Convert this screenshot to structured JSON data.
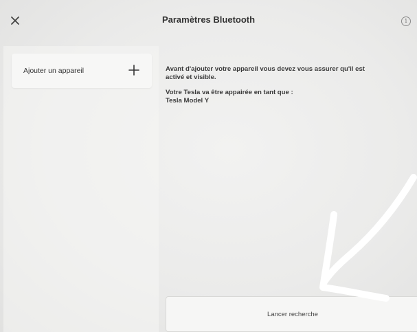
{
  "header": {
    "title": "Paramètres Bluetooth",
    "close_icon": "close-icon",
    "info_icon": "info-icon",
    "info_glyph": "i"
  },
  "sidebar": {
    "add_device_label": "Ajouter un appareil",
    "add_icon": "plus-icon"
  },
  "main": {
    "instruction_line1": "Avant d'ajouter votre appareil vous devez vous assurer qu'il est",
    "instruction_line2": "activé et visible.",
    "pairing_line1": "Votre Tesla va être appairée en tant que :",
    "pairing_name": "Tesla Model Y",
    "search_button_label": "Lancer recherche"
  },
  "colors": {
    "background": "#ececeb",
    "panel": "#f7f7f6",
    "text": "#333333",
    "annotation_arrow": "#ffffff"
  }
}
